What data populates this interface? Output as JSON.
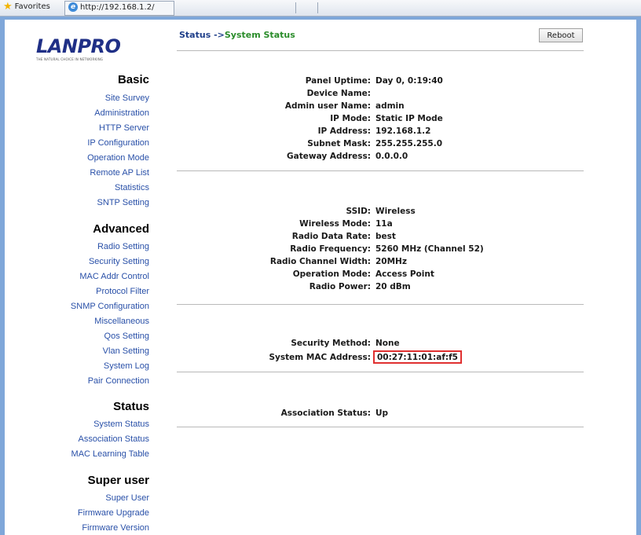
{
  "browser": {
    "favorites_label": "Favorites",
    "address": "http://192.168.1.2/"
  },
  "brand": {
    "logo_text": "LANPRO",
    "tagline": "THE NATURAL CHOICE IN NETWORKING"
  },
  "sidebar": {
    "basic_title": "Basic",
    "basic": [
      "Site Survey",
      "Administration",
      "HTTP Server",
      "IP Configuration",
      "Operation Mode",
      "Remote AP List",
      "Statistics",
      "SNTP Setting"
    ],
    "advanced_title": "Advanced",
    "advanced": [
      "Radio Setting",
      "Security Setting",
      "MAC Addr Control",
      "Protocol Filter",
      "SNMP Configuration",
      "Miscellaneous",
      "Qos Setting",
      "Vlan Setting",
      "System Log",
      "Pair Connection"
    ],
    "status_title": "Status",
    "status": [
      "System Status",
      "Association Status",
      "MAC Learning Table"
    ],
    "super_title": "Super user",
    "super": [
      "Super User",
      "Firmware Upgrade",
      "Firmware Version"
    ]
  },
  "header": {
    "breadcrumb_prefix": "Status ->",
    "breadcrumb_page": "System Status",
    "reboot_label": "Reboot"
  },
  "system": {
    "panel_uptime_label": "Panel Uptime:",
    "panel_uptime": "Day 0, 0:19:40",
    "device_name_label": "Device Name:",
    "device_name": "",
    "admin_label": "Admin user Name:",
    "admin": "admin",
    "ip_mode_label": "IP Mode:",
    "ip_mode": "Static IP Mode",
    "ip_label": "IP Address:",
    "ip": "192.168.1.2",
    "mask_label": "Subnet Mask:",
    "mask": "255.255.255.0",
    "gateway_label": "Gateway Address:",
    "gateway": "0.0.0.0"
  },
  "wireless": {
    "ssid_label": "SSID:",
    "ssid": "Wireless",
    "mode_label": "Wireless Mode:",
    "mode": "11a",
    "rate_label": "Radio Data Rate:",
    "rate": "best",
    "freq_label": "Radio Frequency:",
    "freq": "5260 MHz (Channel 52)",
    "width_label": "Radio Channel Width:",
    "width": "20MHz",
    "op_label": "Operation Mode:",
    "op": "Access Point",
    "power_label": "Radio Power:",
    "power": "20 dBm"
  },
  "security": {
    "method_label": "Security Method:",
    "method": "None",
    "mac_label": "System MAC Address:",
    "mac": "00:27:11:01:af:f5"
  },
  "association": {
    "status_label": "Association Status:",
    "status": "Up"
  },
  "colors": {
    "highlight": "#e03030",
    "nav_link": "#2950a8",
    "breadcrumb_page": "#2a8c2a"
  }
}
